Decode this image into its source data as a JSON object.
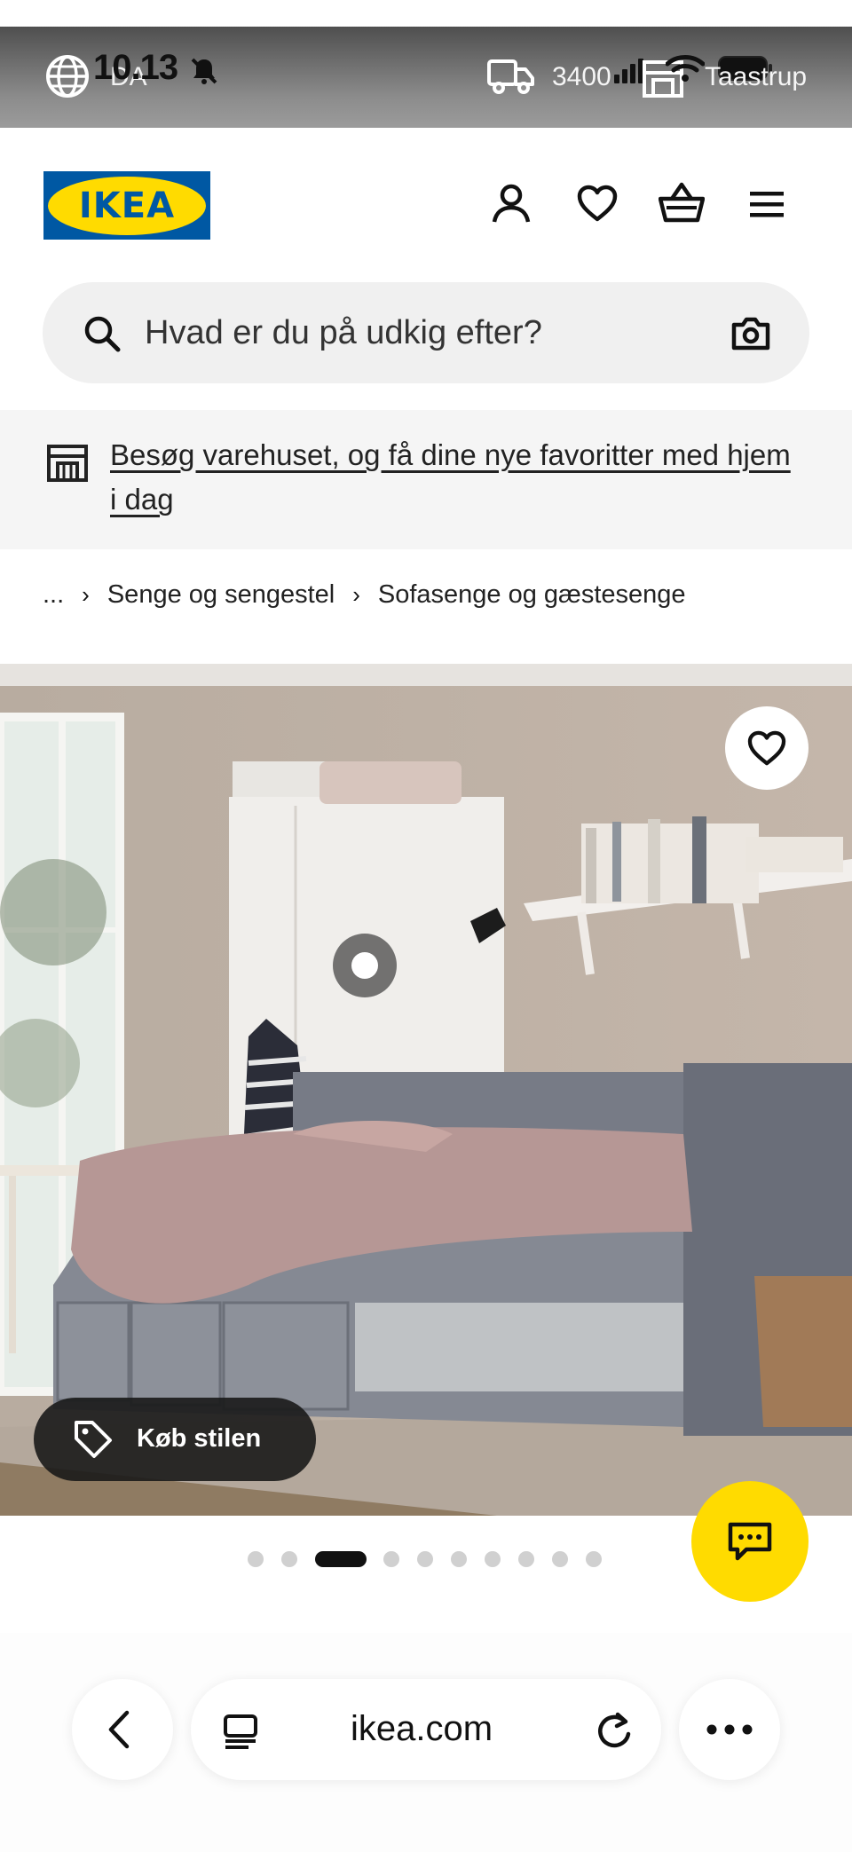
{
  "status_bar": {
    "time": "10.13",
    "language": "DA",
    "delivery_postcode": "3400",
    "store_name": "Taastrup"
  },
  "header": {
    "logo_text": "IKEA",
    "icons": [
      "account-icon",
      "heart-icon",
      "basket-icon",
      "menu-icon"
    ]
  },
  "search": {
    "placeholder": "Hvad er du på udkig efter?"
  },
  "store_banner": {
    "text": "Besøg varehuset, og få dine nye favoritter med hjem i dag"
  },
  "breadcrumb": {
    "ellipsis": "...",
    "items": [
      "Senge og sengestel",
      "Sofasenge og gæstesenge"
    ]
  },
  "product_image": {
    "shop_style_label": "Køb stilen",
    "carousel_total": 10,
    "carousel_active_index": 3
  },
  "browser": {
    "url": "ikea.com"
  },
  "colors": {
    "brand_blue": "#0058a3",
    "brand_yellow": "#ffdb00"
  }
}
